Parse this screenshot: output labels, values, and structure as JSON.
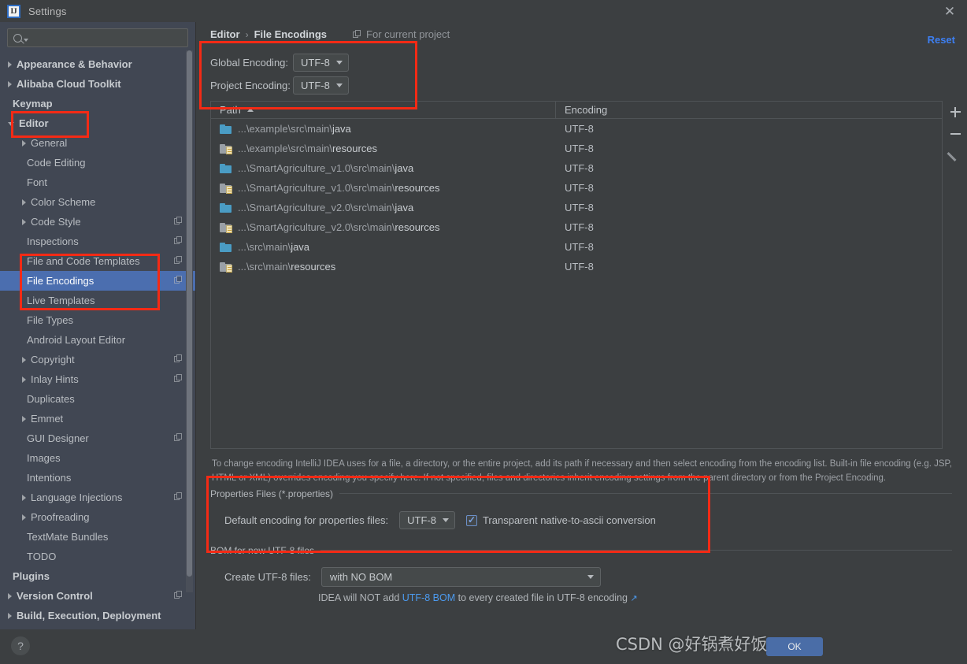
{
  "window": {
    "title": "Settings",
    "logo_text": "IJ",
    "close_label": "✕"
  },
  "sidebar": {
    "search_placeholder": "",
    "search_value": "",
    "items": [
      {
        "label": "Appearance & Behavior",
        "indent": 0,
        "twisty": "closed",
        "bold": true,
        "copy": false,
        "selected": false
      },
      {
        "label": "Alibaba Cloud Toolkit",
        "indent": 0,
        "twisty": "closed",
        "bold": true,
        "copy": false,
        "selected": false
      },
      {
        "label": "Keymap",
        "indent": 0,
        "twisty": "none",
        "bold": true,
        "copy": false,
        "selected": false
      },
      {
        "label": "Editor",
        "indent": 0,
        "twisty": "open",
        "bold": true,
        "copy": false,
        "selected": false
      },
      {
        "label": "General",
        "indent": 1,
        "twisty": "closed",
        "bold": false,
        "copy": false,
        "selected": false
      },
      {
        "label": "Code Editing",
        "indent": 1,
        "twisty": "none",
        "bold": false,
        "copy": false,
        "selected": false
      },
      {
        "label": "Font",
        "indent": 1,
        "twisty": "none",
        "bold": false,
        "copy": false,
        "selected": false
      },
      {
        "label": "Color Scheme",
        "indent": 1,
        "twisty": "closed",
        "bold": false,
        "copy": false,
        "selected": false
      },
      {
        "label": "Code Style",
        "indent": 1,
        "twisty": "closed",
        "bold": false,
        "copy": true,
        "selected": false
      },
      {
        "label": "Inspections",
        "indent": 1,
        "twisty": "none",
        "bold": false,
        "copy": true,
        "selected": false
      },
      {
        "label": "File and Code Templates",
        "indent": 1,
        "twisty": "none",
        "bold": false,
        "copy": true,
        "selected": false
      },
      {
        "label": "File Encodings",
        "indent": 1,
        "twisty": "none",
        "bold": false,
        "copy": true,
        "selected": true
      },
      {
        "label": "Live Templates",
        "indent": 1,
        "twisty": "none",
        "bold": false,
        "copy": false,
        "selected": false
      },
      {
        "label": "File Types",
        "indent": 1,
        "twisty": "none",
        "bold": false,
        "copy": false,
        "selected": false
      },
      {
        "label": "Android Layout Editor",
        "indent": 1,
        "twisty": "none",
        "bold": false,
        "copy": false,
        "selected": false
      },
      {
        "label": "Copyright",
        "indent": 1,
        "twisty": "closed",
        "bold": false,
        "copy": true,
        "selected": false
      },
      {
        "label": "Inlay Hints",
        "indent": 1,
        "twisty": "closed",
        "bold": false,
        "copy": true,
        "selected": false
      },
      {
        "label": "Duplicates",
        "indent": 1,
        "twisty": "none",
        "bold": false,
        "copy": false,
        "selected": false
      },
      {
        "label": "Emmet",
        "indent": 1,
        "twisty": "closed",
        "bold": false,
        "copy": false,
        "selected": false
      },
      {
        "label": "GUI Designer",
        "indent": 1,
        "twisty": "none",
        "bold": false,
        "copy": true,
        "selected": false
      },
      {
        "label": "Images",
        "indent": 1,
        "twisty": "none",
        "bold": false,
        "copy": false,
        "selected": false
      },
      {
        "label": "Intentions",
        "indent": 1,
        "twisty": "none",
        "bold": false,
        "copy": false,
        "selected": false
      },
      {
        "label": "Language Injections",
        "indent": 1,
        "twisty": "closed",
        "bold": false,
        "copy": true,
        "selected": false
      },
      {
        "label": "Proofreading",
        "indent": 1,
        "twisty": "closed",
        "bold": false,
        "copy": false,
        "selected": false
      },
      {
        "label": "TextMate Bundles",
        "indent": 1,
        "twisty": "none",
        "bold": false,
        "copy": false,
        "selected": false
      },
      {
        "label": "TODO",
        "indent": 1,
        "twisty": "none",
        "bold": false,
        "copy": false,
        "selected": false
      },
      {
        "label": "Plugins",
        "indent": 0,
        "twisty": "none",
        "bold": true,
        "copy": false,
        "selected": false
      },
      {
        "label": "Version Control",
        "indent": 0,
        "twisty": "closed",
        "bold": true,
        "copy": true,
        "selected": false
      },
      {
        "label": "Build, Execution, Deployment",
        "indent": 0,
        "twisty": "closed",
        "bold": true,
        "copy": false,
        "selected": false
      }
    ],
    "help_label": "?"
  },
  "header": {
    "breadcrumb_parent": "Editor",
    "breadcrumb_sep": "›",
    "breadcrumb_current": "File Encodings",
    "scope_label": "For current project",
    "reset_label": "Reset"
  },
  "encoding": {
    "global_label": "Global Encoding:",
    "global_value": "UTF-8",
    "project_label": "Project Encoding:",
    "project_value": "UTF-8"
  },
  "table": {
    "columns": [
      "Path",
      "Encoding"
    ],
    "sort_column": "Path",
    "sort_direction": "asc",
    "rows": [
      {
        "icon": "folder-java",
        "prefix": "...\\example\\src\\main\\",
        "leaf": "java",
        "encoding": "UTF-8"
      },
      {
        "icon": "folder-resources",
        "prefix": "...\\example\\src\\main\\",
        "leaf": "resources",
        "encoding": "UTF-8"
      },
      {
        "icon": "folder-java",
        "prefix": "...\\SmartAgriculture_v1.0\\src\\main\\",
        "leaf": "java",
        "encoding": "UTF-8"
      },
      {
        "icon": "folder-resources",
        "prefix": "...\\SmartAgriculture_v1.0\\src\\main\\",
        "leaf": "resources",
        "encoding": "UTF-8"
      },
      {
        "icon": "folder-java",
        "prefix": "...\\SmartAgriculture_v2.0\\src\\main\\",
        "leaf": "java",
        "encoding": "UTF-8"
      },
      {
        "icon": "folder-resources",
        "prefix": "...\\SmartAgriculture_v2.0\\src\\main\\",
        "leaf": "resources",
        "encoding": "UTF-8"
      },
      {
        "icon": "folder-java",
        "prefix": "...\\src\\main\\",
        "leaf": "java",
        "encoding": "UTF-8"
      },
      {
        "icon": "folder-resources",
        "prefix": "...\\src\\main\\",
        "leaf": "resources",
        "encoding": "UTF-8"
      }
    ],
    "buttons": {
      "add": "+",
      "remove": "−",
      "edit": "pencil"
    }
  },
  "help_text": "To change encoding IntelliJ IDEA uses for a file, a directory, or the entire project, add its path if necessary and then select encoding from the encoding list. Built-in file encoding (e.g. JSP, HTML or XML) overrides encoding you specify here. If not specified, files and directories inherit encoding settings from the parent directory or from the Project Encoding.",
  "properties_section": {
    "title": "Properties Files (*.properties)",
    "default_encoding_label": "Default encoding for properties files:",
    "default_encoding_value": "UTF-8",
    "checkbox_label": "Transparent native-to-ascii conversion",
    "checkbox_checked": true
  },
  "bom_section": {
    "title": "BOM for new UTF-8 files",
    "create_label": "Create UTF-8 files:",
    "create_value": "with NO BOM",
    "note_before": "IDEA will NOT add ",
    "note_link": "UTF-8 BOM",
    "note_after": " to every created file in UTF-8 encoding",
    "note_arrow": "↗"
  },
  "footer": {
    "ok_label": "OK",
    "watermark": "CSDN @好锅煮好饭"
  },
  "colors": {
    "accent_selection": "#4b6eaf",
    "link": "#3d7ff2",
    "annotation": "#f42a15",
    "folder_java": "#4a9cc4",
    "dialog_bg": "#3c3f41",
    "sidebar_bg": "#414753"
  }
}
